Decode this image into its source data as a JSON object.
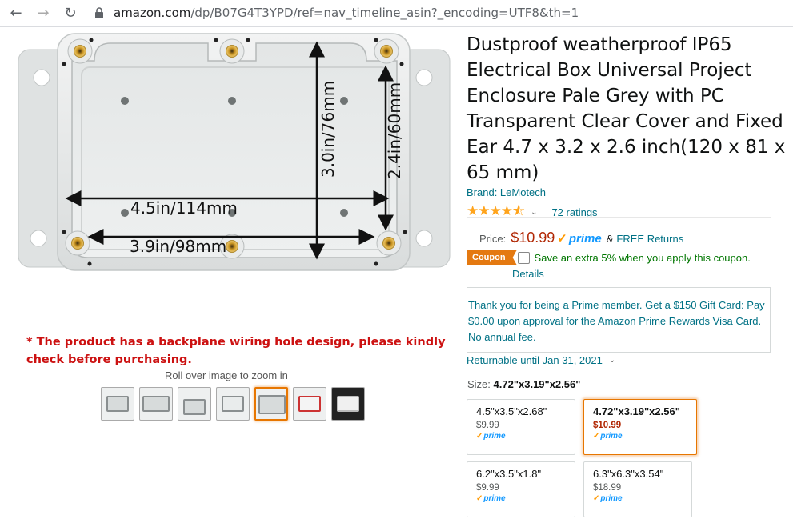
{
  "browser": {
    "url_domain": "amazon.com",
    "url_path": "/dp/B07G4T3YPD/ref=nav_timeline_asin?_encoding=UTF8&th=1"
  },
  "image": {
    "dim_width": "4.5in/114mm",
    "dim_inner_width": "3.9in/98mm",
    "dim_height": "3.0in/76mm",
    "dim_inner_height": "2.4in/60mm",
    "disclaimer": "* The product has a backplane wiring hole design, please kindly check before purchasing.",
    "rollover": "Roll over image to zoom in",
    "thumb_count": 7,
    "active_thumb_index": 4
  },
  "product": {
    "title": "Dustproof weatherproof IP65 Electrical Box Universal Project Enclosure Pale Grey with PC Transparent Clear Cover and Fixed Ear 4.7 x 3.2 x 2.6 inch(120 x 81 x 65 mm)",
    "brand": "Brand: LeMotech",
    "stars": "★★★★⯪",
    "rating_value": 4.5,
    "ratings_count": "72 ratings"
  },
  "pricing": {
    "price_label": "Price:",
    "price": "$10.99",
    "prime": "prime",
    "amp": "&",
    "free_returns": "FREE Returns",
    "coupon_badge": "Coupon",
    "coupon_text": "Save an extra 5% when you apply this coupon.",
    "details": "Details",
    "prime_offer": "Thank you for being a Prime member. Get a $150 Gift Card: Pay $0.00 upon approval for the Amazon Prime Rewards Visa Card. No annual fee.",
    "returnable": "Returnable until Jan 31, 2021"
  },
  "size": {
    "label": "Size:",
    "selected": "4.72\"x3.19\"x2.56\"",
    "options": [
      {
        "size": "4.5\"x3.5\"x2.68\"",
        "price": "$9.99",
        "prime": "prime"
      },
      {
        "size": "4.72\"x3.19\"x2.56\"",
        "price": "$10.99",
        "prime": "prime"
      },
      {
        "size": "6.2\"x3.5\"x1.8\"",
        "price": "$9.99",
        "prime": "prime"
      },
      {
        "size": "6.3\"x6.3\"x3.54\"",
        "price": "$18.99",
        "prime": "prime"
      }
    ]
  },
  "colors": {
    "link": "#007185",
    "price": "#b12704",
    "prime_blue": "#1399ff",
    "accent_orange": "#e47911",
    "disclaimer_red": "#cc1111"
  }
}
